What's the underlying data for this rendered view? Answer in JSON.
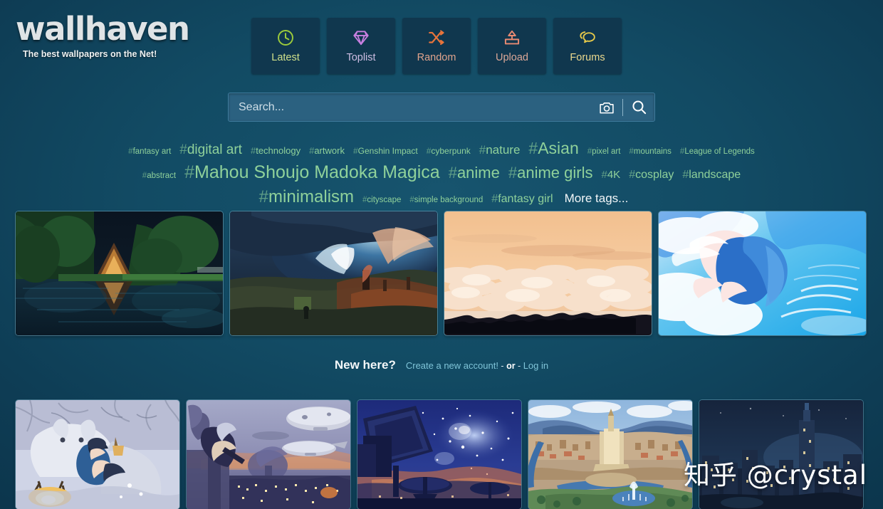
{
  "site": {
    "logo": "wallhaven",
    "tagline": "The best wallpapers on the Net!"
  },
  "colors": {
    "background_outer": "#0b3248",
    "background_inner": "#17546e",
    "nav_button_bg": "#10374e",
    "search_bg": "#2b6180",
    "tag_green": "#8fd19a",
    "link_blue": "#7fc4d8",
    "latest_icon": "#9ccb3b",
    "toplist_icon": "#c77fe0",
    "random_icon": "#e8743b",
    "upload_icon": "#e88a72",
    "forums_icon": "#e8cb4a"
  },
  "nav": {
    "items": [
      {
        "label": "Latest",
        "icon": "clock-icon",
        "icon_color": "#9ccb3b",
        "label_color": "#cfe08a"
      },
      {
        "label": "Toplist",
        "icon": "diamond-icon",
        "icon_color": "#c77fe0",
        "label_color": "#cdbde2"
      },
      {
        "label": "Random",
        "icon": "shuffle-icon",
        "icon_color": "#e8743b",
        "label_color": "#e0a38c"
      },
      {
        "label": "Upload",
        "icon": "upload-icon",
        "icon_color": "#e88a72",
        "label_color": "#dca898"
      },
      {
        "label": "Forums",
        "icon": "chat-icon",
        "icon_color": "#e8cb4a",
        "label_color": "#ecd98e"
      }
    ]
  },
  "search": {
    "value": "",
    "placeholder": "Search...",
    "camera_icon": "camera-icon",
    "submit_icon": "magnifier-icon"
  },
  "tag_cloud": {
    "more_label": "More tags...",
    "rows": [
      [
        {
          "label": "fantasy art",
          "size": 11.5
        },
        {
          "label": "digital art",
          "size": 19
        },
        {
          "label": "technology",
          "size": 13
        },
        {
          "label": "artwork",
          "size": 13
        },
        {
          "label": "Genshin Impact",
          "size": 12
        },
        {
          "label": "cyberpunk",
          "size": 12
        },
        {
          "label": "nature",
          "size": 17
        },
        {
          "label": "Asian",
          "size": 23
        },
        {
          "label": "pixel art",
          "size": 11.5
        },
        {
          "label": "mountains",
          "size": 11.5
        },
        {
          "label": "League of Legends",
          "size": 11.5
        }
      ],
      [
        {
          "label": "abstract",
          "size": 11.5
        },
        {
          "label": "Mahou Shoujo Madoka Magica",
          "size": 25
        },
        {
          "label": "anime",
          "size": 22
        },
        {
          "label": "anime girls",
          "size": 22
        },
        {
          "label": "4K",
          "size": 15
        },
        {
          "label": "cosplay",
          "size": 16
        },
        {
          "label": "landscape",
          "size": 16
        }
      ],
      [
        {
          "label": "minimalism",
          "size": 24
        },
        {
          "label": "cityscape",
          "size": 11.5
        },
        {
          "label": "simple background",
          "size": 11.5
        },
        {
          "label": "fantasy girl",
          "size": 16
        }
      ]
    ]
  },
  "featured": {
    "items": [
      {
        "name": "night-lakeside-cabin"
      },
      {
        "name": "fantasy-valley-sky"
      },
      {
        "name": "sea-of-clouds-sunset"
      },
      {
        "name": "anime-girl-in-water"
      }
    ]
  },
  "new_here": {
    "title": "New here?",
    "create_label": "Create a new account!",
    "separator_prefix": "- ",
    "separator_word": "or",
    "separator_suffix": " -",
    "login_label": "Log in"
  },
  "recent": {
    "items": [
      {
        "name": "snow-wolf-campfire"
      },
      {
        "name": "airships-over-city"
      },
      {
        "name": "radio-telescopes-starry-sky"
      },
      {
        "name": "fantasy-city-rivers"
      },
      {
        "name": "night-skyline-tower"
      }
    ]
  },
  "watermark": {
    "text": "知乎 @crystal"
  }
}
